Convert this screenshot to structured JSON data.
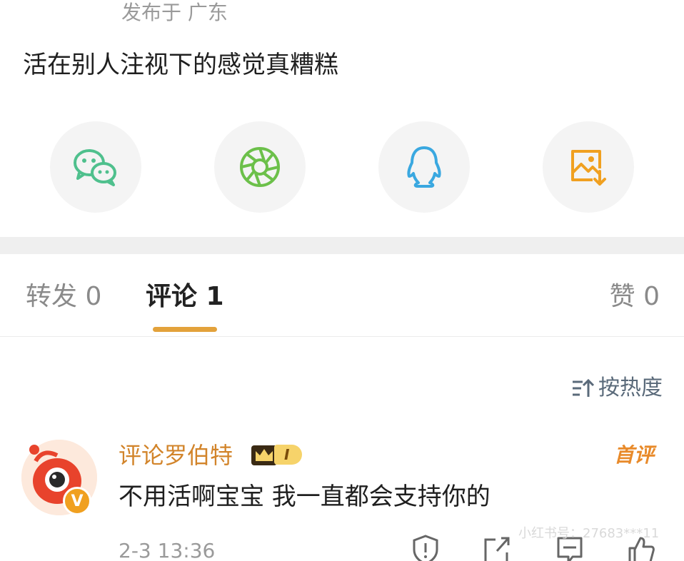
{
  "post": {
    "location": "发布于 广东",
    "text": "活在别人注视下的感觉真糟糕"
  },
  "share": {
    "icons": [
      "wechat-icon",
      "moments-icon",
      "qq-icon",
      "save-image-icon"
    ],
    "colors": {
      "wechat": "#4fc08d",
      "moments": "#6cc04a",
      "qq": "#3aa8e0",
      "save": "#f0a020"
    }
  },
  "tabs": {
    "repost": "转发 0",
    "comments": "评论 1",
    "likes": "赞 0",
    "accent": "#e3a23b"
  },
  "sort": {
    "label": "按热度"
  },
  "comment": {
    "username": "评论罗伯特",
    "member_level": "I",
    "avatar_badge": "V",
    "first_tag": "首评",
    "text": "不用活啊宝宝 我一直都会支持你的",
    "time": "2-3 13:36"
  },
  "watermark": "小红书号：27683***11"
}
